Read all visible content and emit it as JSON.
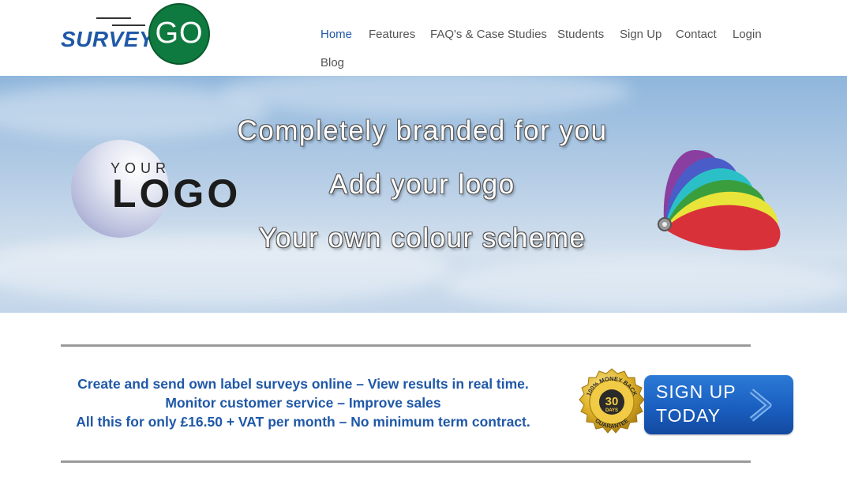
{
  "logo": {
    "word": "SURVEY",
    "circle_text": "GO"
  },
  "nav": {
    "items": [
      {
        "label": "Home",
        "active": true
      },
      {
        "label": "Features"
      },
      {
        "label": "FAQ's & Case Studies"
      },
      {
        "label": "Students"
      },
      {
        "label": "Sign Up"
      },
      {
        "label": "Contact"
      },
      {
        "label": "Login"
      },
      {
        "label": "Blog"
      }
    ]
  },
  "banner": {
    "headlines": [
      "Completely branded for you",
      "Add your logo",
      "Your own colour scheme"
    ],
    "your_logo": {
      "top": "YOUR",
      "bottom": "LOGO"
    }
  },
  "cta": {
    "lines": [
      "Create and send own label surveys online – View results in real time.",
      "Monitor customer service – Improve sales",
      "All this for only £16.50 + VAT per month – No minimum term contract."
    ],
    "badge": {
      "top_text": "100% MONEY BACK",
      "number": "30",
      "unit": "DAYS",
      "bottom_text": "GUARANTEE"
    },
    "button": {
      "line1": "SIGN UP",
      "line2": "TODAY"
    }
  },
  "colors": {
    "brand_blue": "#1f58a8",
    "brand_green": "#0e7a3f",
    "button_blue": "#1a5fc0",
    "badge_gold": "#d8a820"
  }
}
